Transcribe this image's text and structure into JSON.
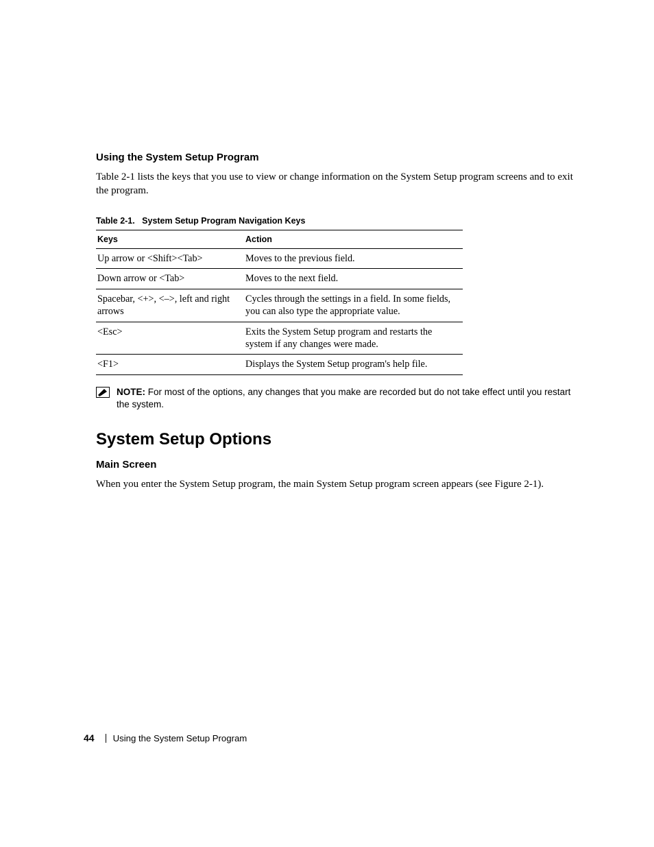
{
  "section1": {
    "heading": "Using the System Setup Program",
    "paragraph": "Table 2-1 lists the keys that you use to view or change information on the System Setup program screens and to exit the program."
  },
  "table": {
    "caption_label": "Table 2-1.",
    "caption_title": "System Setup Program Navigation Keys",
    "headers": {
      "keys": "Keys",
      "action": "Action"
    },
    "rows": [
      {
        "keys": "Up arrow or <Shift><Tab>",
        "action": "Moves to the previous field."
      },
      {
        "keys": "Down arrow or <Tab>",
        "action": "Moves to the next field."
      },
      {
        "keys": "Spacebar, <+>, <–>, left and right arrows",
        "action": "Cycles through the settings in a field. In some fields, you can also type the appropriate value."
      },
      {
        "keys": "<Esc>",
        "action": "Exits the System Setup program and restarts the system if any changes were made."
      },
      {
        "keys": "<F1>",
        "action": "Displays the System Setup program's help file."
      }
    ]
  },
  "note": {
    "label": "NOTE:",
    "text": "For most of the options, any changes that you make are recorded but do not take effect until you restart the system."
  },
  "section2": {
    "heading": "System Setup Options",
    "sub_heading": "Main Screen",
    "paragraph": "When you enter the System Setup program, the main System Setup program screen appears (see Figure 2-1)."
  },
  "footer": {
    "page_number": "44",
    "chapter": "Using the System Setup Program"
  }
}
